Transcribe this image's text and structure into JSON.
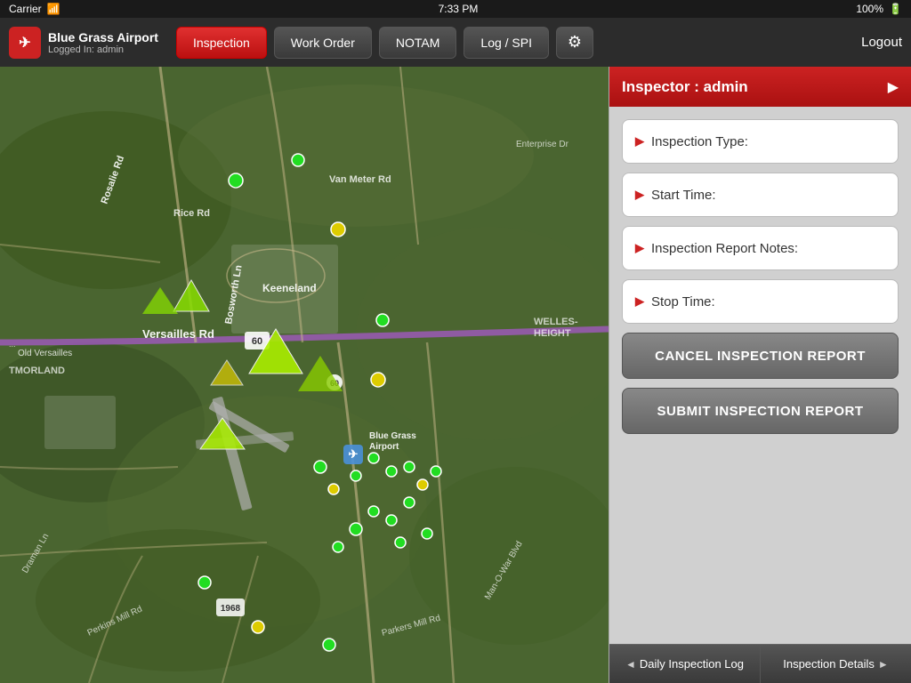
{
  "statusBar": {
    "carrier": "Carrier",
    "time": "7:33 PM",
    "battery": "100%",
    "wifi": "wifi"
  },
  "header": {
    "appName": "Blue Grass Airport",
    "userLabel": "Logged In: admin",
    "logoText": "✈",
    "nav": [
      {
        "id": "inspection",
        "label": "Inspection",
        "active": true
      },
      {
        "id": "workorder",
        "label": "Work Order",
        "active": false
      },
      {
        "id": "notam",
        "label": "NOTAM",
        "active": false
      },
      {
        "id": "logspi",
        "label": "Log / SPI",
        "active": false
      }
    ],
    "settingsIcon": "⚙",
    "logoutLabel": "Logout"
  },
  "panel": {
    "title": "Inspector : admin",
    "arrowIcon": "▶",
    "fields": [
      {
        "id": "inspection-type",
        "label": "Inspection Type:",
        "arrow": "▶"
      },
      {
        "id": "start-time",
        "label": "Start Time:",
        "arrow": "▶"
      },
      {
        "id": "report-notes",
        "label": "Inspection Report Notes:",
        "arrow": "▶"
      },
      {
        "id": "stop-time",
        "label": "Stop Time:",
        "arrow": "▶"
      }
    ],
    "cancelButton": "CANCEL INSPECTION REPORT",
    "submitButton": "SUBMIT INSPECTION REPORT"
  },
  "bottomTabs": [
    {
      "id": "daily-log",
      "label": "Daily Inspection Log",
      "arrow": "◄"
    },
    {
      "id": "inspection-details",
      "label": "Inspection Details",
      "arrow": "►"
    }
  ],
  "map": {
    "roadLabel": "Versailles Rd",
    "routeLabel": "60"
  }
}
